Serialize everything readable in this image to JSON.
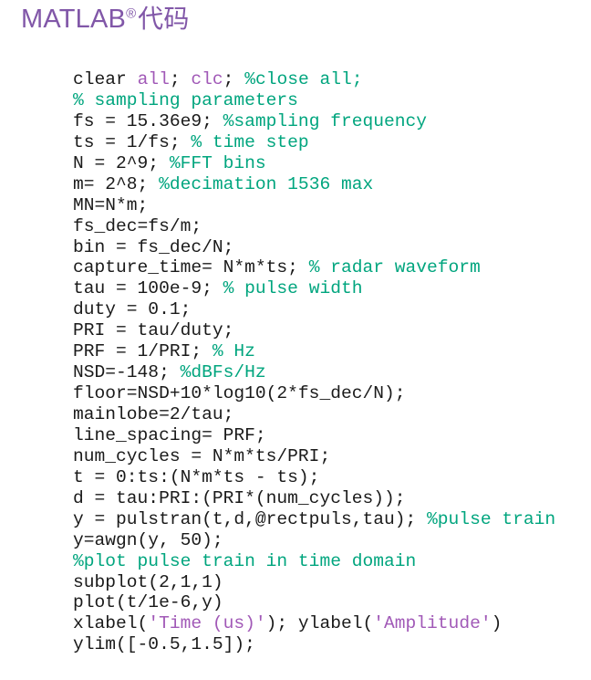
{
  "heading": {
    "product": "MATLAB",
    "registered_mark": "®",
    "suffix": "代码",
    "color": "#8157a8"
  },
  "colors": {
    "code_plain": "#1a1a1a",
    "keyword": "#a159b7",
    "comment": "#00a57e",
    "string": "#a159b7",
    "background": "#ffffff"
  },
  "code": {
    "language": "matlab",
    "lines": [
      [
        {
          "t": "clear ",
          "k": "plain"
        },
        {
          "t": "all",
          "k": "keyword"
        },
        {
          "t": "; ",
          "k": "plain"
        },
        {
          "t": "clc",
          "k": "keyword"
        },
        {
          "t": "; ",
          "k": "plain"
        },
        {
          "t": "%close all;",
          "k": "comment"
        }
      ],
      [
        {
          "t": "% sampling parameters",
          "k": "comment"
        }
      ],
      [
        {
          "t": "fs = 15.36e9; ",
          "k": "plain"
        },
        {
          "t": "%sampling frequency",
          "k": "comment"
        }
      ],
      [
        {
          "t": "ts = 1/fs; ",
          "k": "plain"
        },
        {
          "t": "% time step",
          "k": "comment"
        }
      ],
      [
        {
          "t": "N = 2^9; ",
          "k": "plain"
        },
        {
          "t": "%FFT bins",
          "k": "comment"
        }
      ],
      [
        {
          "t": "m= 2^8; ",
          "k": "plain"
        },
        {
          "t": "%decimation 1536 max",
          "k": "comment"
        }
      ],
      [
        {
          "t": "MN=N*m;",
          "k": "plain"
        }
      ],
      [
        {
          "t": "fs_dec=fs/m;",
          "k": "plain"
        }
      ],
      [
        {
          "t": "bin = fs_dec/N;",
          "k": "plain"
        }
      ],
      [
        {
          "t": "capture_time= N*m*ts; ",
          "k": "plain"
        },
        {
          "t": "% radar waveform",
          "k": "comment"
        }
      ],
      [
        {
          "t": "tau = 100e-9; ",
          "k": "plain"
        },
        {
          "t": "% pulse width",
          "k": "comment"
        }
      ],
      [
        {
          "t": "duty = 0.1;",
          "k": "plain"
        }
      ],
      [
        {
          "t": "PRI = tau/duty;",
          "k": "plain"
        }
      ],
      [
        {
          "t": "PRF = 1/PRI; ",
          "k": "plain"
        },
        {
          "t": "% Hz",
          "k": "comment"
        }
      ],
      [
        {
          "t": "NSD=-148; ",
          "k": "plain"
        },
        {
          "t": "%dBFs/Hz",
          "k": "comment"
        }
      ],
      [
        {
          "t": "floor=NSD+10*log10(2*fs_dec/N);",
          "k": "plain"
        }
      ],
      [
        {
          "t": "mainlobe=2/tau;",
          "k": "plain"
        }
      ],
      [
        {
          "t": "line_spacing= PRF;",
          "k": "plain"
        }
      ],
      [
        {
          "t": "num_cycles = N*m*ts/PRI;",
          "k": "plain"
        }
      ],
      [
        {
          "t": "t = 0:ts:(N*m*ts - ts);",
          "k": "plain"
        }
      ],
      [
        {
          "t": "d = tau:PRI:(PRI*(num_cycles));",
          "k": "plain"
        }
      ],
      [
        {
          "t": "y = pulstran(t,d,@rectpuls,tau); ",
          "k": "plain"
        },
        {
          "t": "%pulse train",
          "k": "comment"
        }
      ],
      [
        {
          "t": "y=awgn(y, 50);",
          "k": "plain"
        }
      ],
      [
        {
          "t": "%plot pulse train in time domain",
          "k": "comment"
        }
      ],
      [
        {
          "t": "subplot(2,1,1)",
          "k": "plain"
        }
      ],
      [
        {
          "t": "plot(t/1e-6,y)",
          "k": "plain"
        }
      ],
      [
        {
          "t": "xlabel(",
          "k": "plain"
        },
        {
          "t": "'Time (us)'",
          "k": "string"
        },
        {
          "t": "); ylabel(",
          "k": "plain"
        },
        {
          "t": "'Amplitude'",
          "k": "string"
        },
        {
          "t": ")",
          "k": "plain"
        }
      ],
      [
        {
          "t": "ylim([-0.5,1.5]);",
          "k": "plain"
        }
      ]
    ]
  }
}
